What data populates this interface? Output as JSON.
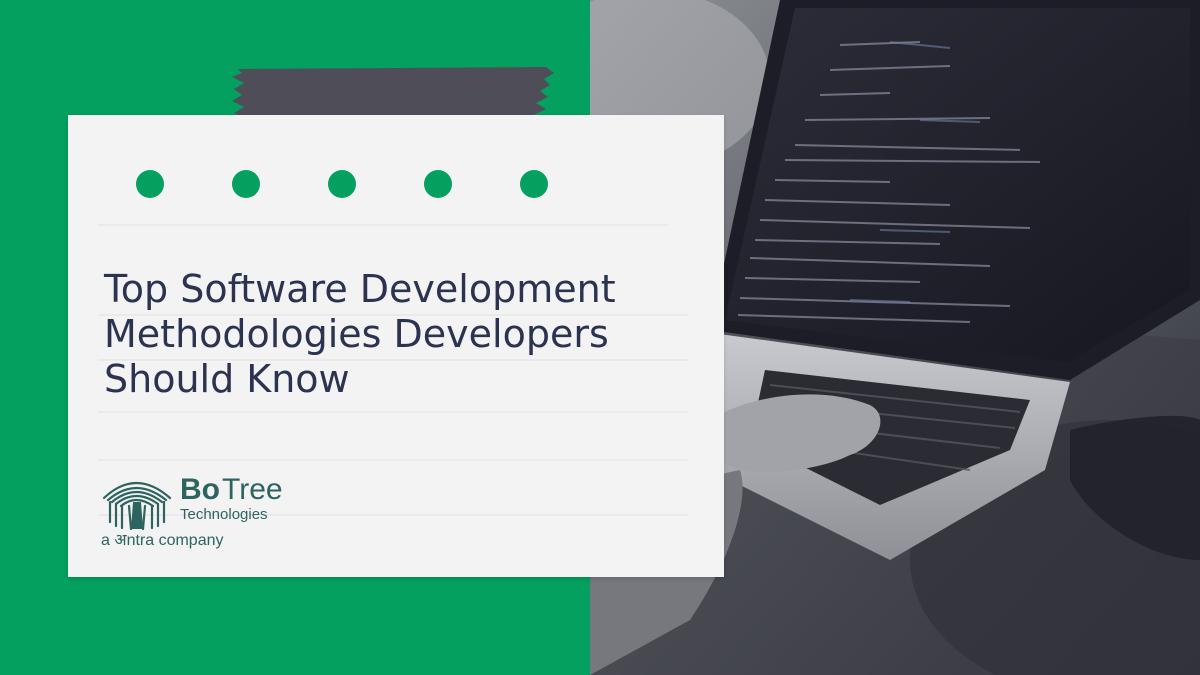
{
  "headline": {
    "line1": "Top Software Development",
    "line2": "Methodologies Developers",
    "line3": "Should Know"
  },
  "logo": {
    "brand_bold": "Bo",
    "brand_regular": "Tree",
    "subtitle": "Technologies",
    "tagline": "a अntra company"
  },
  "colors": {
    "background_green": "#03a05f",
    "card": "#f3f3f3",
    "headline": "#2c3350",
    "tape": "#4f4d58",
    "logo_teal": "#2d6460"
  },
  "icons": {
    "logo_mark": "banyan-tree-logo-icon",
    "decorative_dots": "green-dot-icon",
    "photo": "laptop-typing-photo"
  }
}
